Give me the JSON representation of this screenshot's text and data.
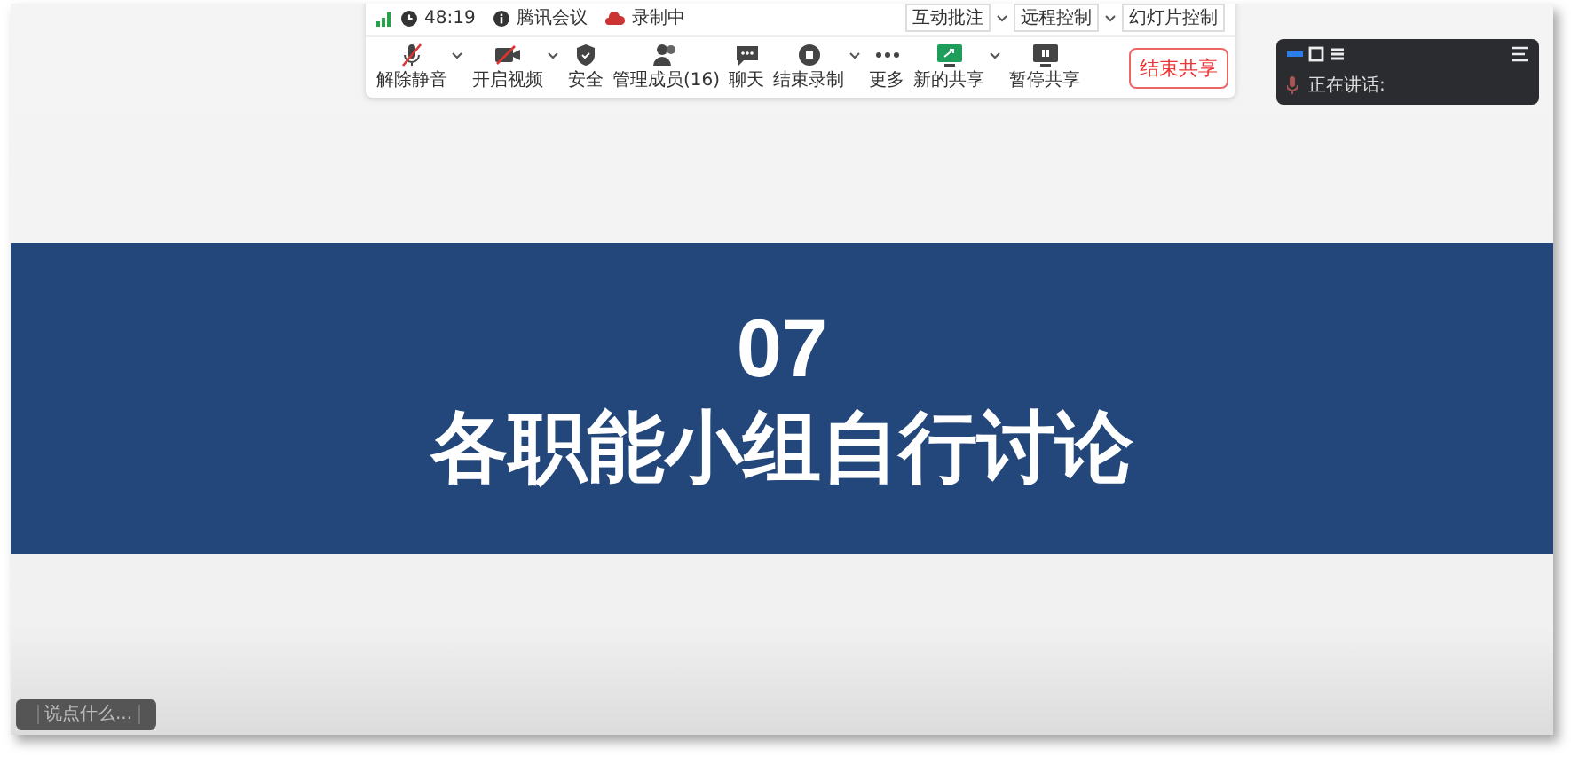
{
  "meeting_bar": {
    "timer": "48:19",
    "app_name": "腾讯会议",
    "recording": "录制中",
    "top_buttons": [
      {
        "label": "互动批注",
        "dropdown": true
      },
      {
        "label": "远程控制",
        "dropdown": true
      },
      {
        "label": "幻灯片控制",
        "dropdown": false
      }
    ],
    "tools": [
      {
        "kind": "mic",
        "label": "解除静音",
        "dropdown": true
      },
      {
        "kind": "camera",
        "label": "开启视频",
        "dropdown": true
      },
      {
        "kind": "shield",
        "label": "安全",
        "dropdown": false
      },
      {
        "kind": "people",
        "label": "管理成员(16)",
        "dropdown": false
      },
      {
        "kind": "chat",
        "label": "聊天",
        "dropdown": false
      },
      {
        "kind": "record",
        "label": "结束录制",
        "dropdown": true
      },
      {
        "kind": "more",
        "label": "更多",
        "dropdown": false
      },
      {
        "kind": "share",
        "label": "新的共享",
        "dropdown": true
      },
      {
        "kind": "pause",
        "label": "暂停共享",
        "dropdown": false
      }
    ],
    "end_share": "结束共享"
  },
  "speaker_panel": {
    "label": "正在讲话:"
  },
  "slide": {
    "number": "07",
    "title": "各职能小组自行讨论"
  },
  "chat_input": {
    "placeholder": "说点什么..."
  }
}
